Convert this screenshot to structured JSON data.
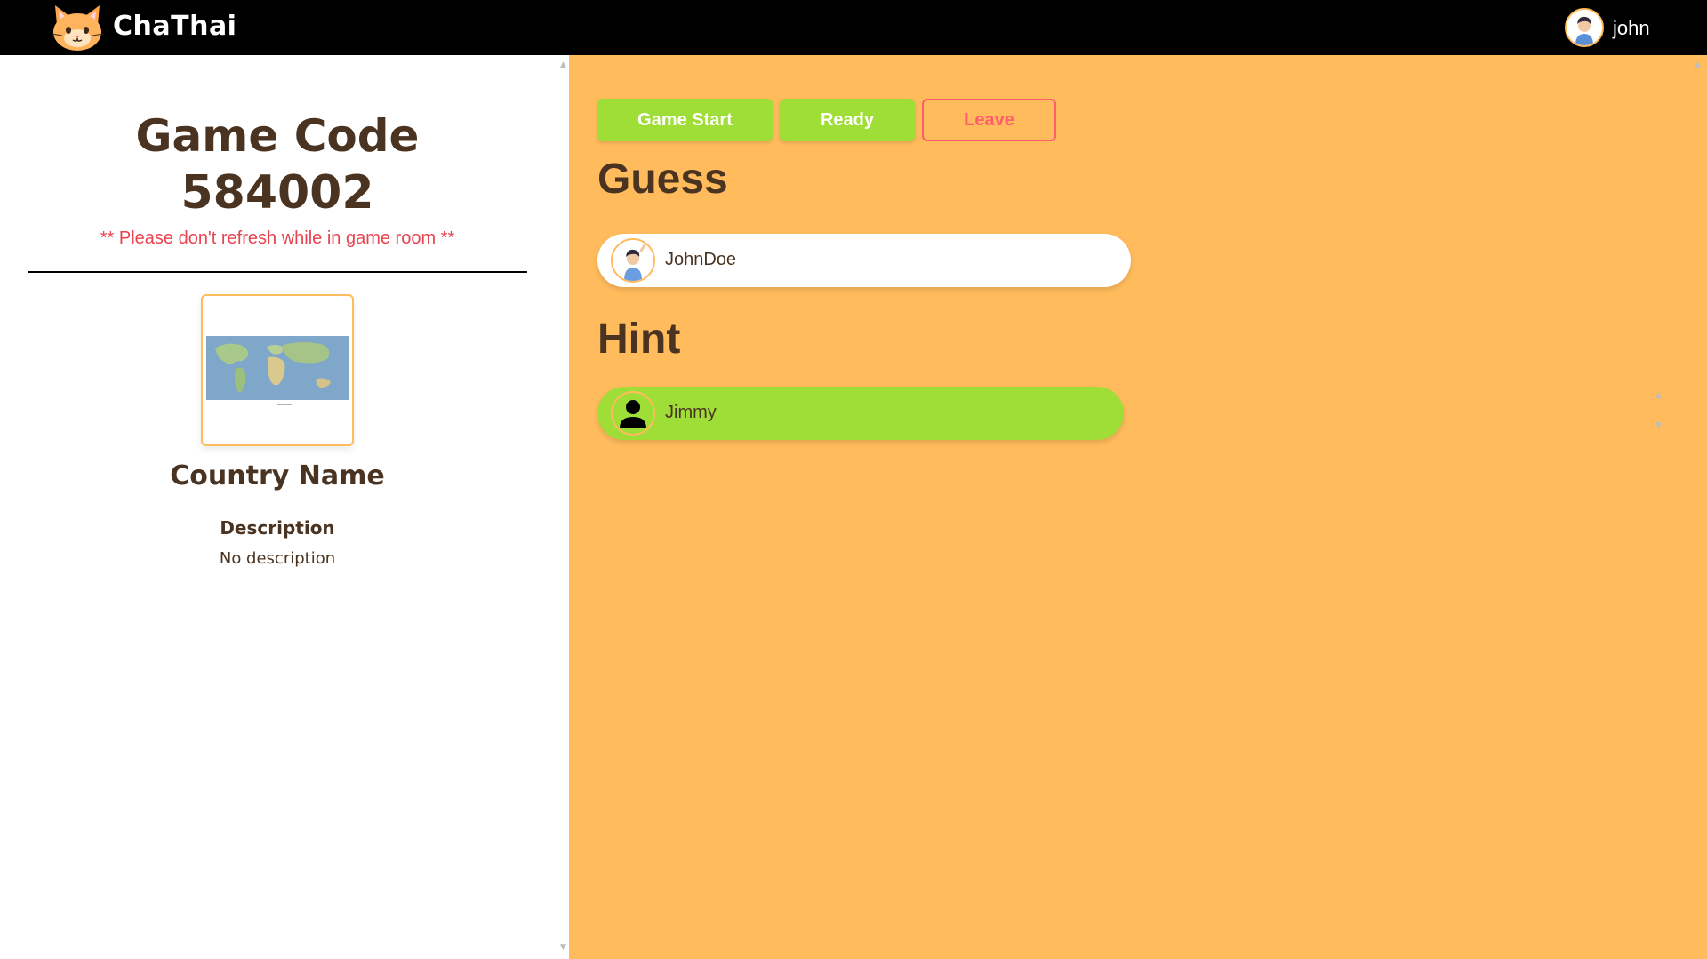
{
  "header": {
    "brand": "ChaThai",
    "user_name": "john",
    "logo_icon": "cat-logo-icon",
    "avatar_icon": "user-avatar-icon",
    "colors": {
      "bar": "#000000",
      "accent": "#ffbb5c"
    }
  },
  "left_panel": {
    "game_code_title": "Game Code",
    "game_code_value": "584002",
    "warning": "** Please don't refresh while in game room **",
    "card_image": "world-map-icon",
    "country_name": "Country Name",
    "description_label": "Description",
    "description_value": "No description"
  },
  "right_panel": {
    "buttons": {
      "game_start": "Game Start",
      "ready": "Ready",
      "leave": "Leave"
    },
    "guess_title": "Guess",
    "hint_title": "Hint",
    "guess_players": [
      {
        "name": "JohnDoe",
        "avatar": "cartoon-boy-avatar-icon"
      }
    ],
    "hint_players": [
      {
        "name": "Jimmy",
        "avatar": "default-person-icon"
      }
    ],
    "colors": {
      "background": "#ffbb5c",
      "button_green": "#9fde37",
      "leave_red": "#ff5d6c",
      "text_brown": "#4a3421",
      "warning_red": "#e8444f"
    }
  }
}
